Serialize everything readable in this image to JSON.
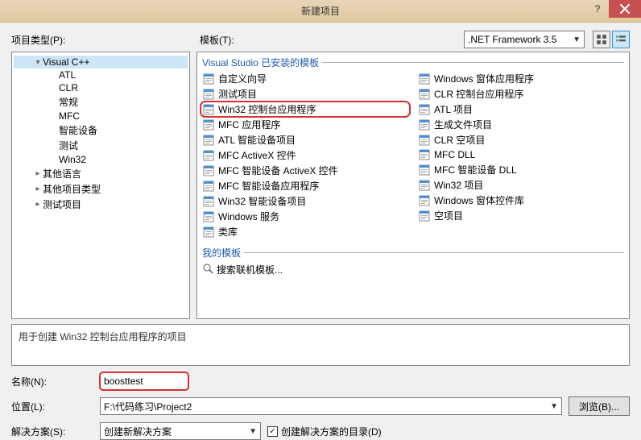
{
  "window": {
    "title": "新建项目"
  },
  "labels": {
    "project_types": "项目类型(P):",
    "templates": "模板(T):",
    "framework_selected": ".NET Framework 3.5",
    "installed_group": "Visual Studio 已安装的模板",
    "my_templates_group": "我的模板",
    "search_online": "搜索联机模板...",
    "description": "用于创建 Win32 控制台应用程序的项目",
    "name_label": "名称(N):",
    "location_label": "位置(L):",
    "solution_label": "解决方案(S):",
    "browse_btn": "浏览(B)...",
    "create_dir_chk": "创建解决方案的目录(D)"
  },
  "tree": [
    {
      "label": "Visual C++",
      "depth": 1,
      "toggle": "▾",
      "selected": true
    },
    {
      "label": "ATL",
      "depth": 2
    },
    {
      "label": "CLR",
      "depth": 2
    },
    {
      "label": "常规",
      "depth": 2
    },
    {
      "label": "MFC",
      "depth": 2
    },
    {
      "label": "智能设备",
      "depth": 2
    },
    {
      "label": "测试",
      "depth": 2
    },
    {
      "label": "Win32",
      "depth": 2
    },
    {
      "label": "其他语言",
      "depth": 1,
      "toggle": "▸"
    },
    {
      "label": "其他项目类型",
      "depth": 1,
      "toggle": "▸"
    },
    {
      "label": "测试项目",
      "depth": 1,
      "toggle": "▸"
    }
  ],
  "templates_left": [
    {
      "label": "自定义向导"
    },
    {
      "label": "测试项目"
    },
    {
      "label": "Win32 控制台应用程序",
      "highlight": true
    },
    {
      "label": "MFC 应用程序"
    },
    {
      "label": "ATL 智能设备项目"
    },
    {
      "label": "MFC ActiveX 控件"
    },
    {
      "label": "MFC 智能设备 ActiveX 控件"
    },
    {
      "label": "MFC 智能设备应用程序"
    },
    {
      "label": "Win32 智能设备项目"
    },
    {
      "label": "Windows 服务"
    },
    {
      "label": "类库"
    }
  ],
  "templates_right": [
    {
      "label": "Windows 窗体应用程序"
    },
    {
      "label": "CLR 控制台应用程序"
    },
    {
      "label": "ATL 项目"
    },
    {
      "label": "生成文件项目"
    },
    {
      "label": "CLR 空项目"
    },
    {
      "label": "MFC DLL"
    },
    {
      "label": "MFC 智能设备 DLL"
    },
    {
      "label": "Win32 项目"
    },
    {
      "label": "Windows 窗体控件库"
    },
    {
      "label": "空项目"
    }
  ],
  "form": {
    "name_value": "boosttest",
    "location_value": "F:\\代码练习\\Project2",
    "solution_value": "创建新解决方案",
    "create_dir_checked": true
  }
}
